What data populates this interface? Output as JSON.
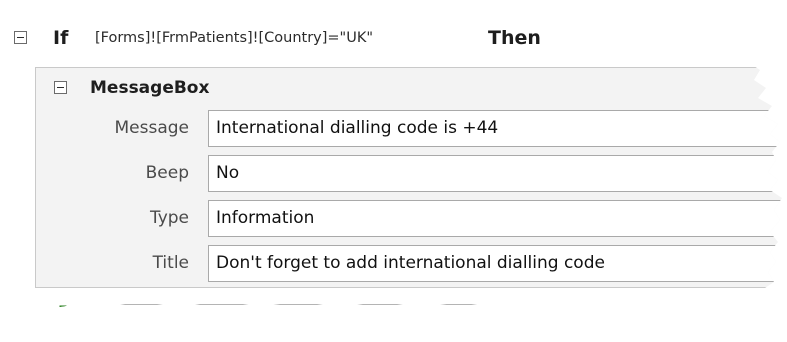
{
  "if_block": {
    "keyword_if": "If",
    "condition": "[Forms]![FrmPatients]![Country]=\"UK\"",
    "keyword_then": "Then"
  },
  "action": {
    "name": "MessageBox",
    "arguments": [
      {
        "label": "Message",
        "value": "International dialling code is +44"
      },
      {
        "label": "Beep",
        "value": "No"
      },
      {
        "label": "Type",
        "value": "Information"
      },
      {
        "label": "Title",
        "value": "Don't forget to add international dialling code"
      }
    ]
  },
  "add_action": {
    "placeholder": "Add New Action",
    "icon": "green-plus-icon"
  },
  "colors": {
    "accent_green": "#3aa52b",
    "keyword": "#1e1e1e",
    "condition_text": "#2b2b2b"
  }
}
